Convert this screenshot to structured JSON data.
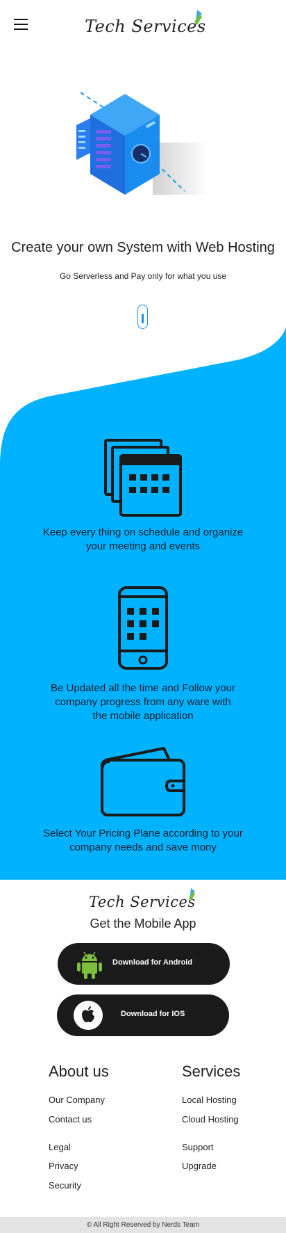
{
  "header": {
    "brand": "Tech Services",
    "menu_icon": "hamburger-icon"
  },
  "hero": {
    "title": "Create your own System with Web Hosting",
    "subtitle": "Go Serverless and Pay only for what you use",
    "illustration": "server-illustration",
    "scroll_icon": "scroll-mouse-icon"
  },
  "features": [
    {
      "icon": "calendar-icon",
      "text": "Keep every thing on schedule and organize your meeting and events"
    },
    {
      "icon": "smartphone-icon",
      "text": "Be Updated all the time and Follow your company progress from any ware with the mobile application"
    },
    {
      "icon": "wallet-icon",
      "text": "Select Your Pricing Plane according to your company needs and save mony"
    }
  ],
  "footer": {
    "brand": "Tech Services",
    "get_app": "Get the Mobile App",
    "android_label": "Download for Android",
    "ios_label": "Download for IOS",
    "about": {
      "title": "About us",
      "links": [
        "Our Company",
        "Contact us",
        "Legal",
        "Privacy",
        "Security"
      ]
    },
    "services": {
      "title": "Services",
      "links": [
        "Local Hosting",
        "Cloud Hosting",
        "Support",
        "Upgrade"
      ]
    },
    "copyright": "© All Right Reserved by Nerds Team"
  },
  "colors": {
    "accent": "#00b2ff",
    "button": "#1b1b1b",
    "android_green": "#7cbf3d",
    "bottom_bar": "#e3e3e3"
  }
}
